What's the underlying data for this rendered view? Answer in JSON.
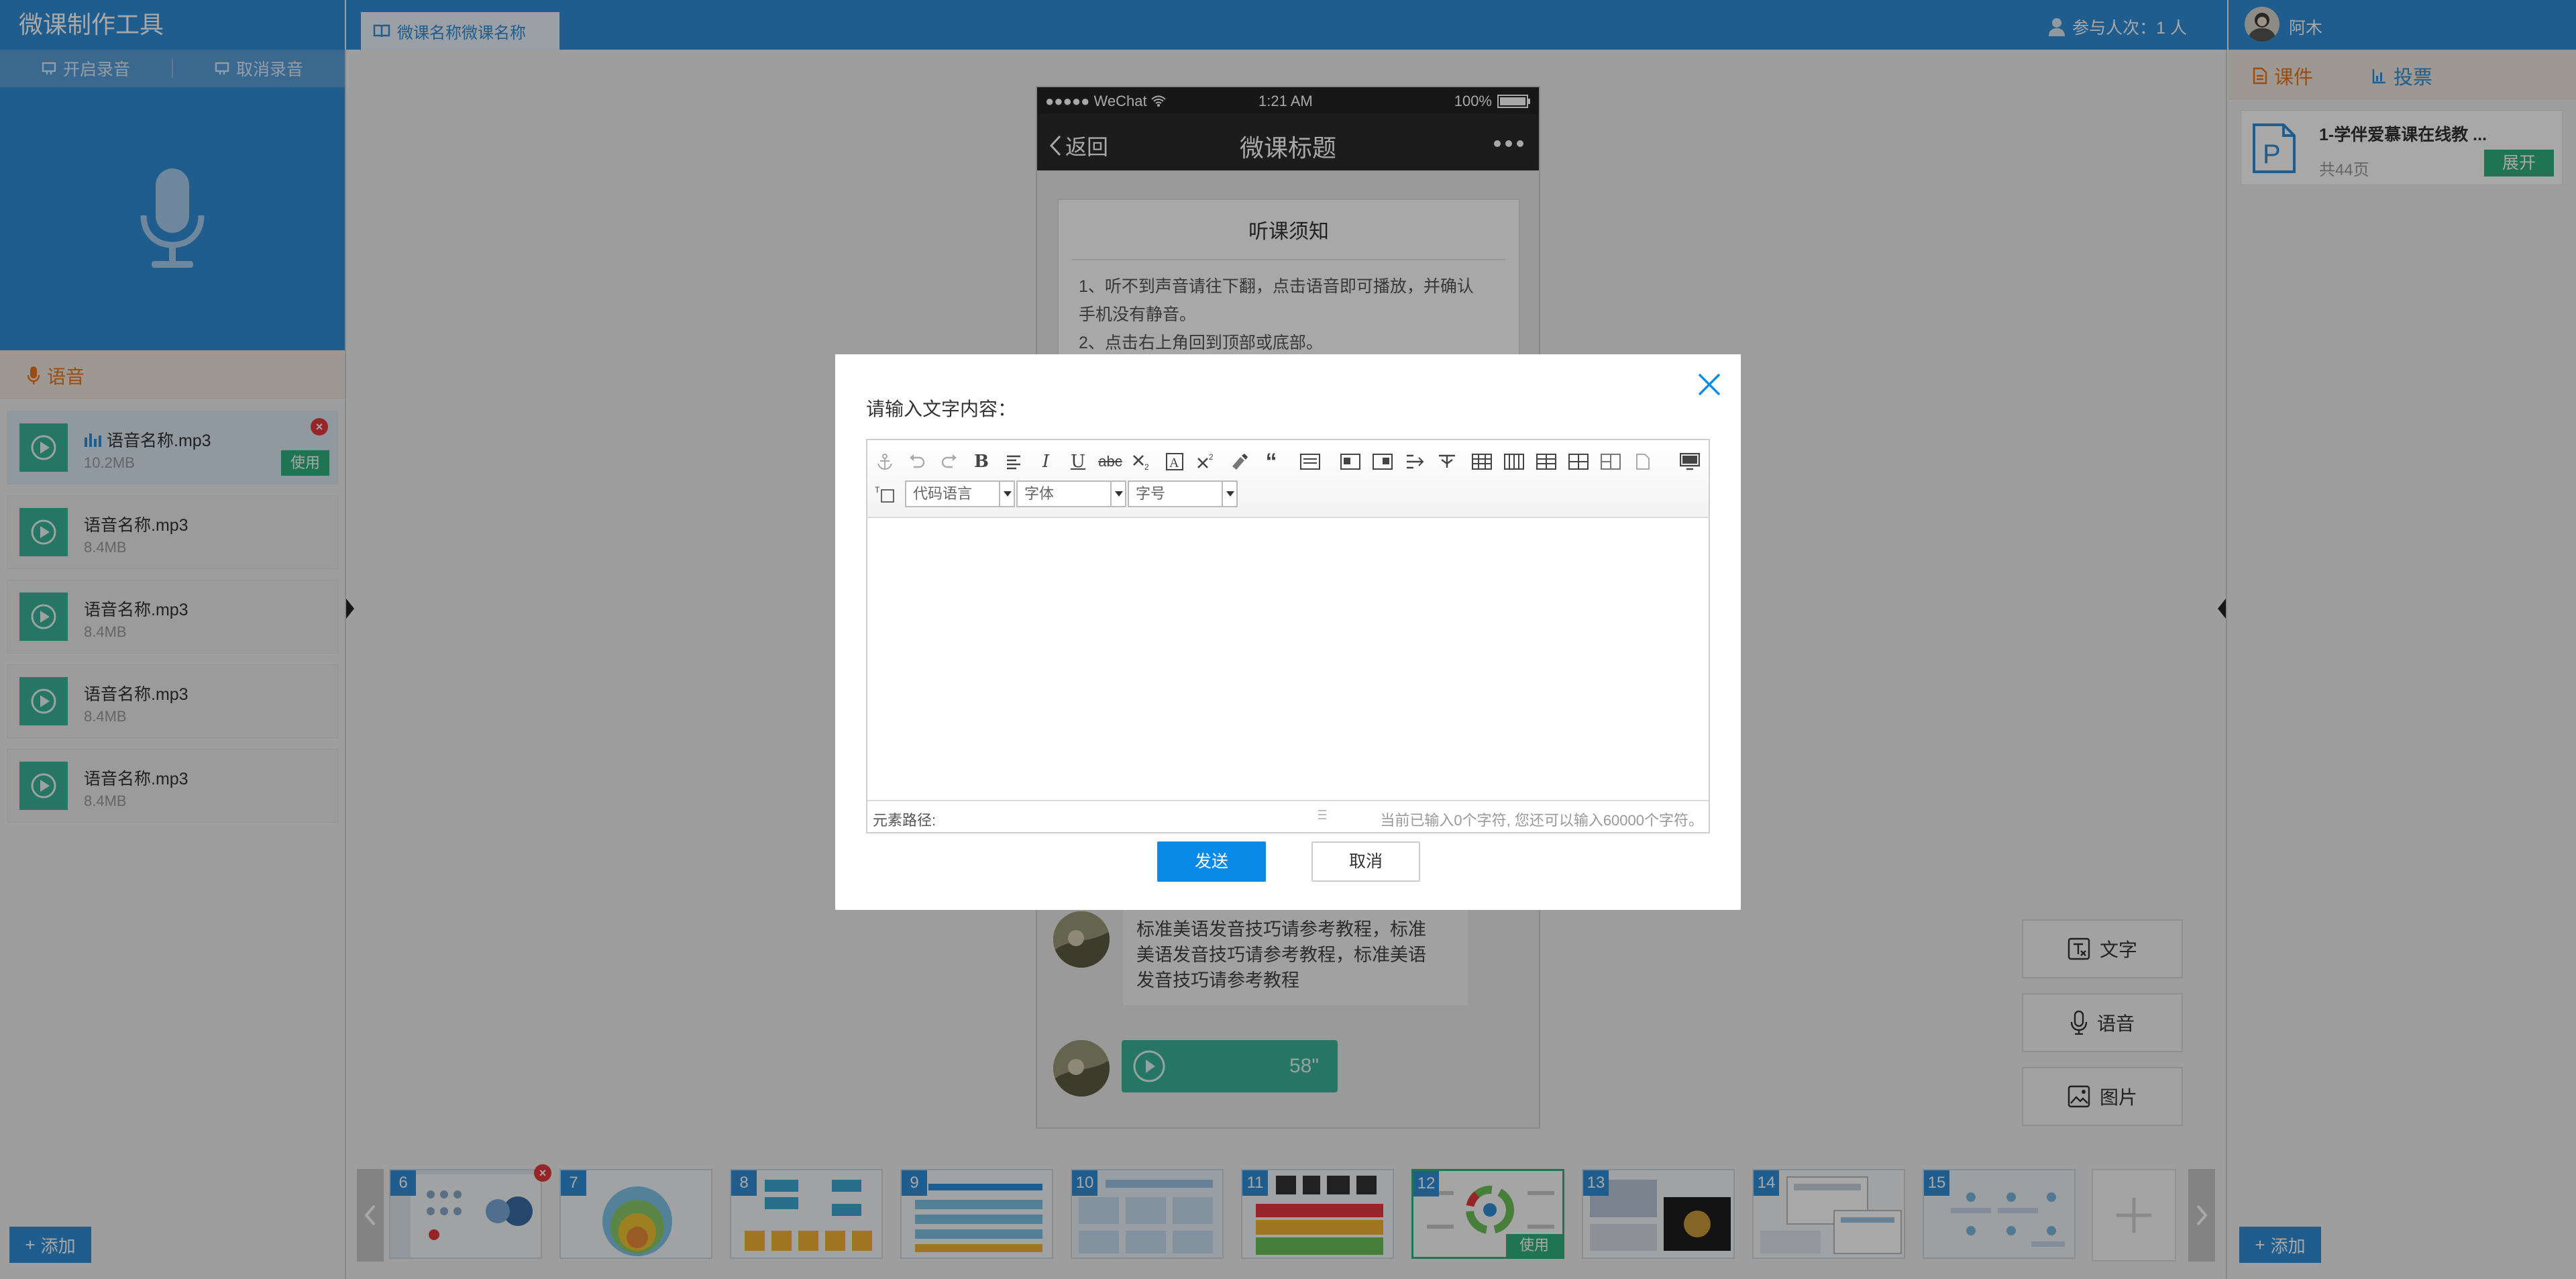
{
  "app": {
    "title": "微课制作工具"
  },
  "record": {
    "start_label": "开启录音",
    "cancel_label": "取消录音"
  },
  "top": {
    "course_tab": "微课名称微课名称",
    "participants": "参与人次：1 人",
    "user_name": "阿木"
  },
  "voice": {
    "tab_label": "语音",
    "items": [
      {
        "name": "语音名称.mp3",
        "size": "10.2MB",
        "badge": "使用"
      },
      {
        "name": "语音名称.mp3",
        "size": "8.4MB"
      },
      {
        "name": "语音名称.mp3",
        "size": "8.4MB"
      },
      {
        "name": "语音名称.mp3",
        "size": "8.4MB"
      },
      {
        "name": "语音名称.mp3",
        "size": "8.4MB"
      }
    ],
    "add_label": "添加"
  },
  "phone": {
    "status": {
      "carrier": "●●●●● WeChat",
      "time": "1:21 AM",
      "battery": "100%"
    },
    "nav": {
      "back_label": "返回",
      "title": "微课标题"
    },
    "notice": {
      "title": "听课须知",
      "line1": "1、听不到声音请往下翻，点击语音即可播放，并确认",
      "line2": "手机没有静音。",
      "line3": "2、点击右上角回到顶部或底部。"
    },
    "chat_text_1": "标准美语发音技巧请参考教程，标准",
    "chat_text_2": "美语发音技巧请参考教程，标准美语",
    "chat_text_3": "发音技巧请参考教程",
    "audio_duration": "58\""
  },
  "modal": {
    "prompt": "请输入文字内容：",
    "code_lang": "代码语言",
    "font": "字体",
    "font_size": "字号",
    "path_label": "元素路径:",
    "char_count": "当前已输入0个字符, 您还可以输入60000个字符。",
    "send_label": "发送",
    "cancel_label": "取消"
  },
  "right": {
    "tab_courseware": "课件",
    "tab_vote": "投票",
    "card": {
      "title": "1-学伴爱慕课在线教 ...",
      "pages": "共44页",
      "expand": "展开"
    },
    "add_label": "添加"
  },
  "actions": {
    "text": "文字",
    "voice": "语音",
    "image": "图片"
  },
  "filmstrip": {
    "thumbs": [
      {
        "num": "6"
      },
      {
        "num": "7"
      },
      {
        "num": "8"
      },
      {
        "num": "9"
      },
      {
        "num": "10"
      },
      {
        "num": "11"
      },
      {
        "num": "12",
        "badge": "使用"
      },
      {
        "num": "13"
      },
      {
        "num": "14"
      },
      {
        "num": "15"
      }
    ]
  },
  "colors": {
    "primary": "#2e8dd6",
    "accent_orange": "#e8761e",
    "green": "#2fb07e",
    "send_blue": "#0a8ae8"
  }
}
